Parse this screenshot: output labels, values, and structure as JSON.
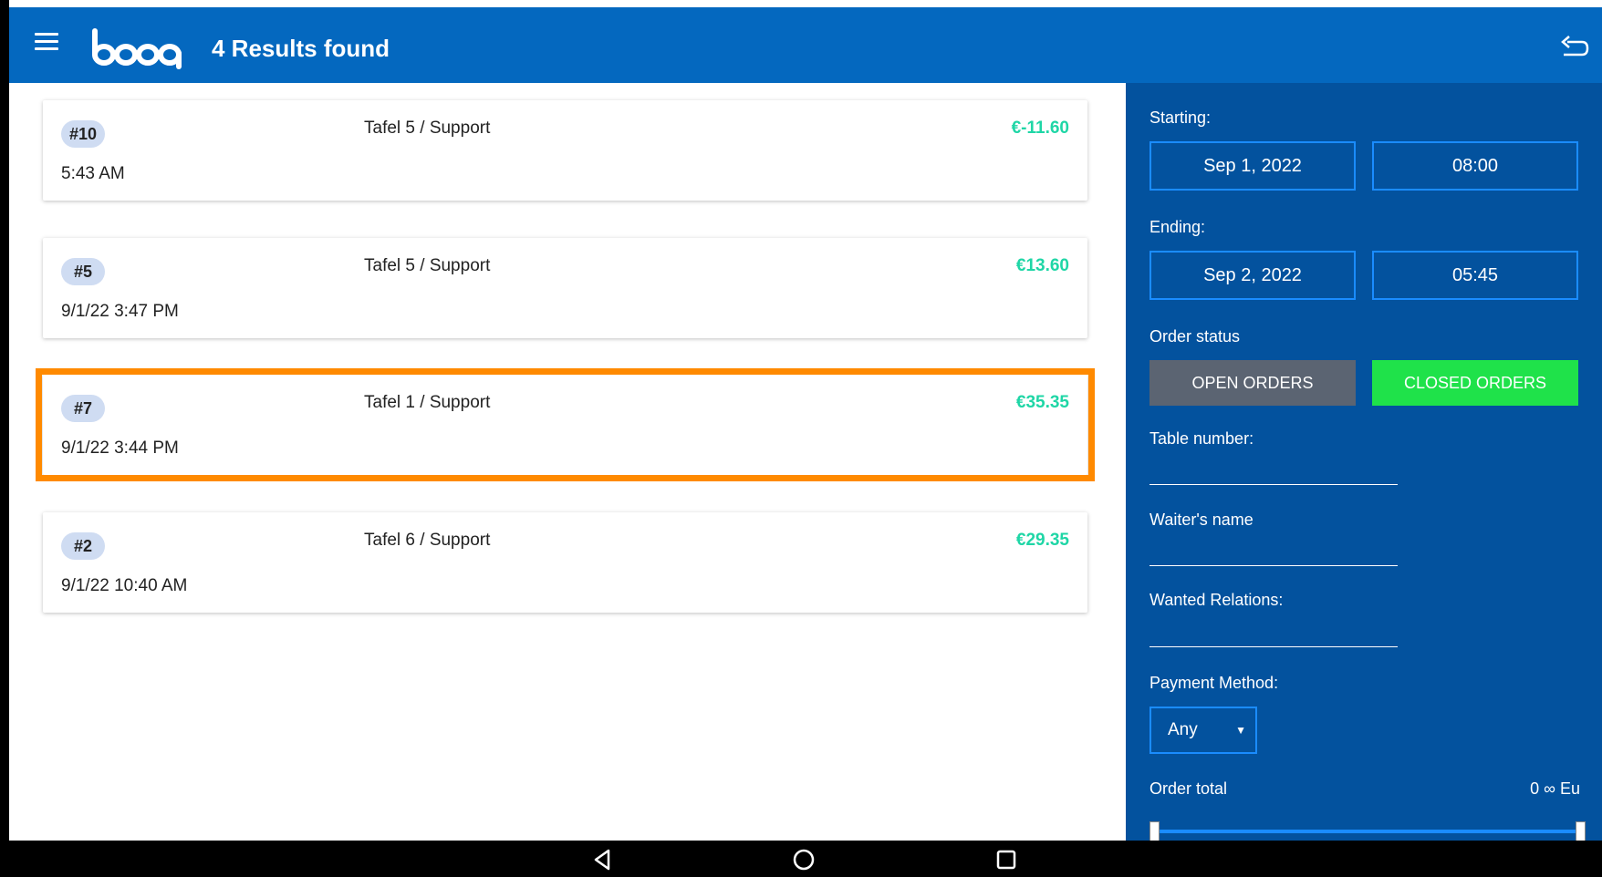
{
  "header": {
    "logo_text": "booq",
    "title": "4 Results found",
    "menu_icon": "hamburger-menu-icon",
    "back_icon": "undo-arrow-icon"
  },
  "orders": [
    {
      "number": "#10",
      "table": "Tafel 5 / Support",
      "amount": "€-11.60",
      "time": "5:43 AM"
    },
    {
      "number": "#5",
      "table": "Tafel 5 / Support",
      "amount": "€13.60",
      "time": "9/1/22 3:47 PM"
    },
    {
      "number": "#7",
      "table": "Tafel 1 / Support",
      "amount": "€35.35",
      "time": "9/1/22 3:44 PM"
    },
    {
      "number": "#2",
      "table": "Tafel 6 / Support",
      "amount": "€29.35",
      "time": "9/1/22 10:40 AM"
    }
  ],
  "filters": {
    "starting_label": "Starting:",
    "starting_date": "Sep 1, 2022",
    "starting_time": "08:00",
    "ending_label": "Ending:",
    "ending_date": "Sep 2, 2022",
    "ending_time": "05:45",
    "order_status_label": "Order status",
    "open_orders": "OPEN ORDERS",
    "closed_orders": "CLOSED ORDERS",
    "table_number_label": "Table number:",
    "waiter_label": "Waiter's name",
    "relations_label": "Wanted Relations:",
    "payment_label": "Payment Method:",
    "payment_value": "Any",
    "order_total_label": "Order total",
    "order_total_range": "0 ∞ Eu"
  },
  "colors": {
    "header_bg": "#0468bf",
    "panel_bg": "#03529e",
    "amount": "#1fd6a6",
    "closed_active": "#1fe24a",
    "open_inactive": "#5b6472",
    "highlight": "#ff8a00"
  },
  "navbar": {
    "back_icon": "nav-back-triangle-icon",
    "home_icon": "nav-home-circle-icon",
    "recents_icon": "nav-recents-square-icon"
  }
}
